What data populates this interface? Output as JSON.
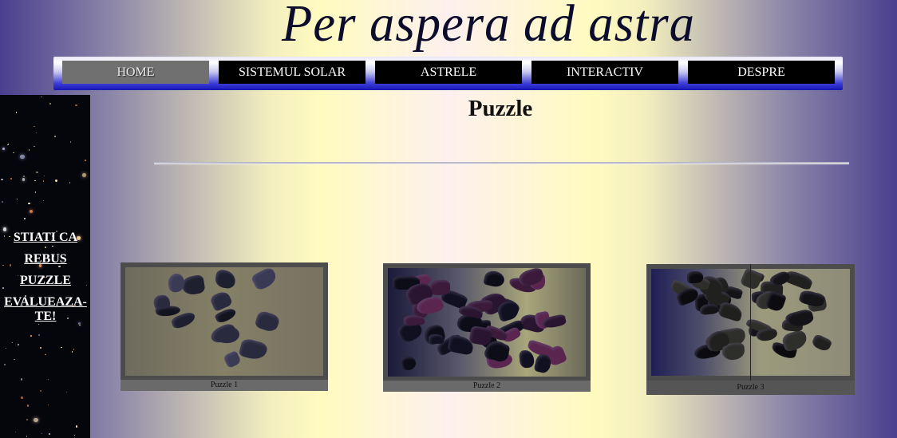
{
  "header": {
    "title": "Per aspera ad astra"
  },
  "nav": {
    "items": [
      {
        "label": "HOME"
      },
      {
        "label": "SISTEMUL SOLAR"
      },
      {
        "label": "ASTRELE"
      },
      {
        "label": "INTERACTIV"
      },
      {
        "label": "DESPRE"
      }
    ]
  },
  "sidebar": {
    "items": [
      {
        "label": "STIATI CA"
      },
      {
        "label": "REBUS"
      },
      {
        "label": "PUZZLE"
      },
      {
        "label": "EVALUEAZA-TE!"
      }
    ]
  },
  "main": {
    "title": "Puzzle",
    "puzzles": [
      {
        "caption": "Puzzle 1"
      },
      {
        "caption": "Puzzle 2"
      },
      {
        "caption": "Puzzle 3"
      }
    ]
  },
  "colors": {
    "nav_button": "#000000",
    "nav_active": "#707070",
    "nav_bar": "#1616b4",
    "sidebar_bg": "#05050c"
  }
}
